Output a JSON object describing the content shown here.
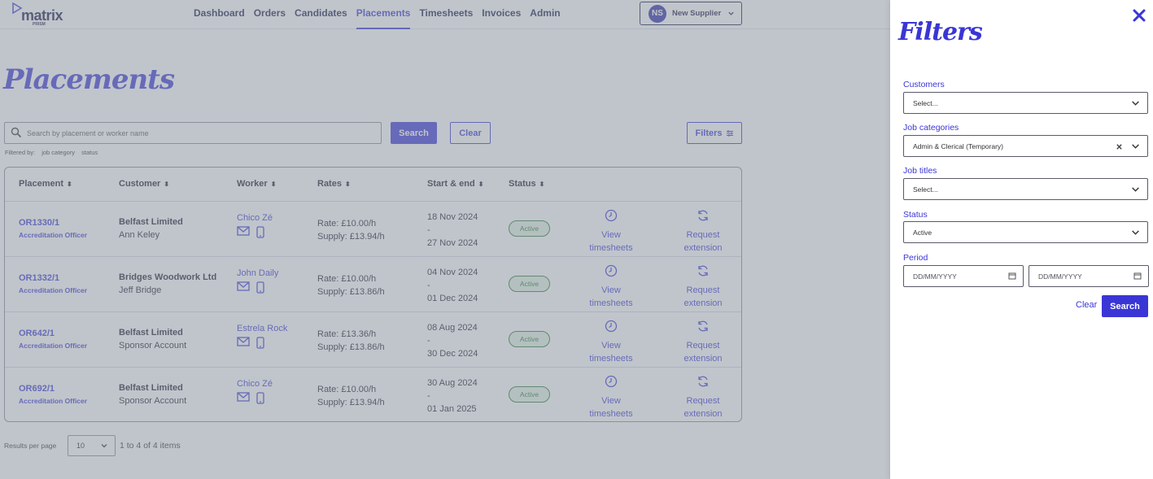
{
  "topbar": {
    "logo_text": "matrix",
    "logo_sub": "PRISM",
    "nav": [
      "Dashboard",
      "Orders",
      "Candidates",
      "Placements",
      "Timesheets",
      "Invoices",
      "Admin"
    ],
    "user_initials": "NS",
    "user_name": "New Supplier"
  },
  "page": {
    "title": "Placements",
    "search_placeholder": "Search by placement or worker name",
    "search_label": "Search",
    "clear_label": "Clear",
    "filters_label": "Filters",
    "filtered_by_label": "Filtered by:",
    "filtered_by_tags": [
      "job category",
      "status"
    ]
  },
  "table": {
    "headers": [
      "Placement",
      "Customer",
      "Worker",
      "Rates",
      "Start & end",
      "Status"
    ],
    "rows": [
      {
        "id": "OR1330/1",
        "role": "Accreditation Officer",
        "customer": "Belfast Limited",
        "contact": "Ann Keley",
        "worker": "Chico Zé",
        "rate": "Rate: £10.00/h",
        "supply": "Supply: £13.94/h",
        "start": "18 Nov 2024",
        "sep": "-",
        "end": "27 Nov 2024",
        "status": "Active"
      },
      {
        "id": "OR1332/1",
        "role": "Accreditation Officer",
        "customer": "Bridges Woodwork Ltd",
        "contact": "Jeff Bridge",
        "worker": "John Daily",
        "rate": "Rate: £10.00/h",
        "supply": "Supply: £13.86/h",
        "start": "04 Nov 2024",
        "sep": "-",
        "end": "01 Dec 2024",
        "status": "Active"
      },
      {
        "id": "OR642/1",
        "role": "Accreditation Officer",
        "customer": "Belfast Limited",
        "contact": "Sponsor Account",
        "worker": "Estrela Rock",
        "rate": "Rate: £13.36/h",
        "supply": "Supply: £13.86/h",
        "start": "08 Aug 2024",
        "sep": "-",
        "end": "30 Dec 2024",
        "status": "Active"
      },
      {
        "id": "OR692/1",
        "role": "Accreditation Officer",
        "customer": "Belfast Limited",
        "contact": "Sponsor Account",
        "worker": "Chico Zé",
        "rate": "Rate: £10.00/h",
        "supply": "Supply: £13.94/h",
        "start": "30 Aug 2024",
        "sep": "-",
        "end": "01 Jan 2025",
        "status": "Active"
      }
    ],
    "action_view": [
      "View",
      "timesheets"
    ],
    "action_extend": [
      "Request",
      "extension"
    ]
  },
  "pagination": {
    "results_label": "Results per page",
    "per_page": "10",
    "range": "1 to 4 of 4 items"
  },
  "filters": {
    "title": "Filters",
    "customers_label": "Customers",
    "customers_value": "Select...",
    "job_categories_label": "Job categories",
    "job_categories_value": "Admin & Clerical (Temporary)",
    "job_titles_label": "Job titles",
    "job_titles_value": "Select...",
    "status_label": "Status",
    "status_value": "Active",
    "period_label": "Period",
    "date_placeholder_from": "DD/MM/YYYY",
    "date_placeholder_to": "DD/MM/YYYY",
    "clear_label": "Clear",
    "search_label": "Search"
  },
  "colors": {
    "accent": "#3a36d6",
    "active_badge": "#2f7a3a"
  }
}
